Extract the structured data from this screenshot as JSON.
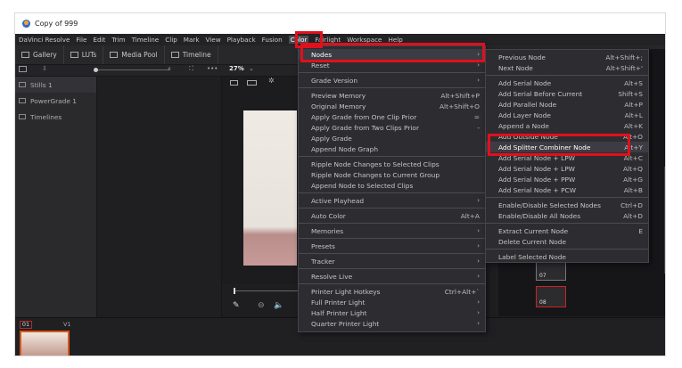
{
  "window": {
    "title": "Copy of 999"
  },
  "menubar": {
    "items": [
      "DaVinci Resolve",
      "File",
      "Edit",
      "Trim",
      "Timeline",
      "Clip",
      "Mark",
      "View",
      "Playback",
      "Fusion",
      "Color",
      "Fairlight",
      "Workspace",
      "Help"
    ],
    "active": "Color"
  },
  "toolbar": {
    "gallery": "Gallery",
    "luts": "LUTs",
    "media_pool": "Media Pool",
    "timeline": "Timeline"
  },
  "subbar": {
    "zoom": "27%",
    "more": "•••"
  },
  "left_panel": {
    "items": [
      "Stills 1",
      "PowerGrade 1",
      "Timelines"
    ]
  },
  "timeline": {
    "clip_number": "01",
    "track": "V1"
  },
  "nodes": [
    {
      "label": "07"
    },
    {
      "label": "08"
    }
  ],
  "color_menu": {
    "items": [
      {
        "label": "Nodes",
        "submenu": true,
        "highlighted": true
      },
      {
        "label": "Reset",
        "submenu": true
      },
      {
        "sep": true
      },
      {
        "label": "Grade Version",
        "submenu": true
      },
      {
        "sep": true
      },
      {
        "label": "Preview Memory",
        "shortcut": "Alt+Shift+P"
      },
      {
        "label": "Original Memory",
        "shortcut": "Alt+Shift+O"
      },
      {
        "label": "Apply Grade from One Clip Prior",
        "shortcut": "="
      },
      {
        "label": "Apply Grade from Two Clips Prior",
        "shortcut": "-"
      },
      {
        "label": "Apply Grade",
        "shortcut": ""
      },
      {
        "label": "Append Node Graph",
        "shortcut": ""
      },
      {
        "sep": true
      },
      {
        "label": "Ripple Node Changes to Selected Clips",
        "shortcut": ""
      },
      {
        "label": "Ripple Node Changes to Current Group",
        "shortcut": ""
      },
      {
        "label": "Append Node to Selected Clips",
        "shortcut": ""
      },
      {
        "sep": true
      },
      {
        "label": "Active Playhead",
        "submenu": true
      },
      {
        "sep": true
      },
      {
        "label": "Auto Color",
        "shortcut": "Alt+A"
      },
      {
        "sep": true
      },
      {
        "label": "Memories",
        "submenu": true
      },
      {
        "sep": true
      },
      {
        "label": "Presets",
        "submenu": true
      },
      {
        "sep": true
      },
      {
        "label": "Tracker",
        "submenu": true
      },
      {
        "sep": true
      },
      {
        "label": "Resolve Live",
        "submenu": true
      },
      {
        "sep": true
      },
      {
        "label": "Printer Light Hotkeys",
        "shortcut": "Ctrl+Alt+`"
      },
      {
        "label": "Full Printer Light",
        "submenu": true
      },
      {
        "label": "Half Printer Light",
        "submenu": true
      },
      {
        "label": "Quarter Printer Light",
        "submenu": true
      }
    ]
  },
  "nodes_submenu": {
    "items": [
      {
        "label": "Previous Node",
        "shortcut": "Alt+Shift+;"
      },
      {
        "label": "Next Node",
        "shortcut": "Alt+Shift+'"
      },
      {
        "sep": true
      },
      {
        "label": "Add Serial Node",
        "shortcut": "Alt+S"
      },
      {
        "label": "Add Serial Before Current",
        "shortcut": "Shift+S"
      },
      {
        "label": "Add Parallel Node",
        "shortcut": "Alt+P"
      },
      {
        "label": "Add Layer Node",
        "shortcut": "Alt+L"
      },
      {
        "label": "Append a Node",
        "shortcut": "Alt+K"
      },
      {
        "label": "Add Outside Node",
        "shortcut": "Alt+O"
      },
      {
        "label": "Add Splitter Combiner Node",
        "shortcut": "Alt+Y",
        "highlighted": true
      },
      {
        "label": "Add Serial Node + LPW",
        "shortcut": "Alt+C"
      },
      {
        "label": "Add Serial Node + LPW",
        "shortcut": "Alt+Q"
      },
      {
        "label": "Add Serial Node + PPW",
        "shortcut": "Alt+G"
      },
      {
        "label": "Add Serial Node + PCW",
        "shortcut": "Alt+B"
      },
      {
        "sep": true
      },
      {
        "label": "Enable/Disable Selected Nodes",
        "shortcut": "Ctrl+D"
      },
      {
        "label": "Enable/Disable All Nodes",
        "shortcut": "Alt+D"
      },
      {
        "sep": true
      },
      {
        "label": "Extract Current Node",
        "shortcut": "E"
      },
      {
        "label": "Delete Current Node",
        "shortcut": ""
      },
      {
        "sep": true
      },
      {
        "label": "Label Selected Node",
        "shortcut": ""
      }
    ]
  },
  "colors": {
    "highlight": "#e0101c",
    "menu_bg": "#2d2d31"
  }
}
